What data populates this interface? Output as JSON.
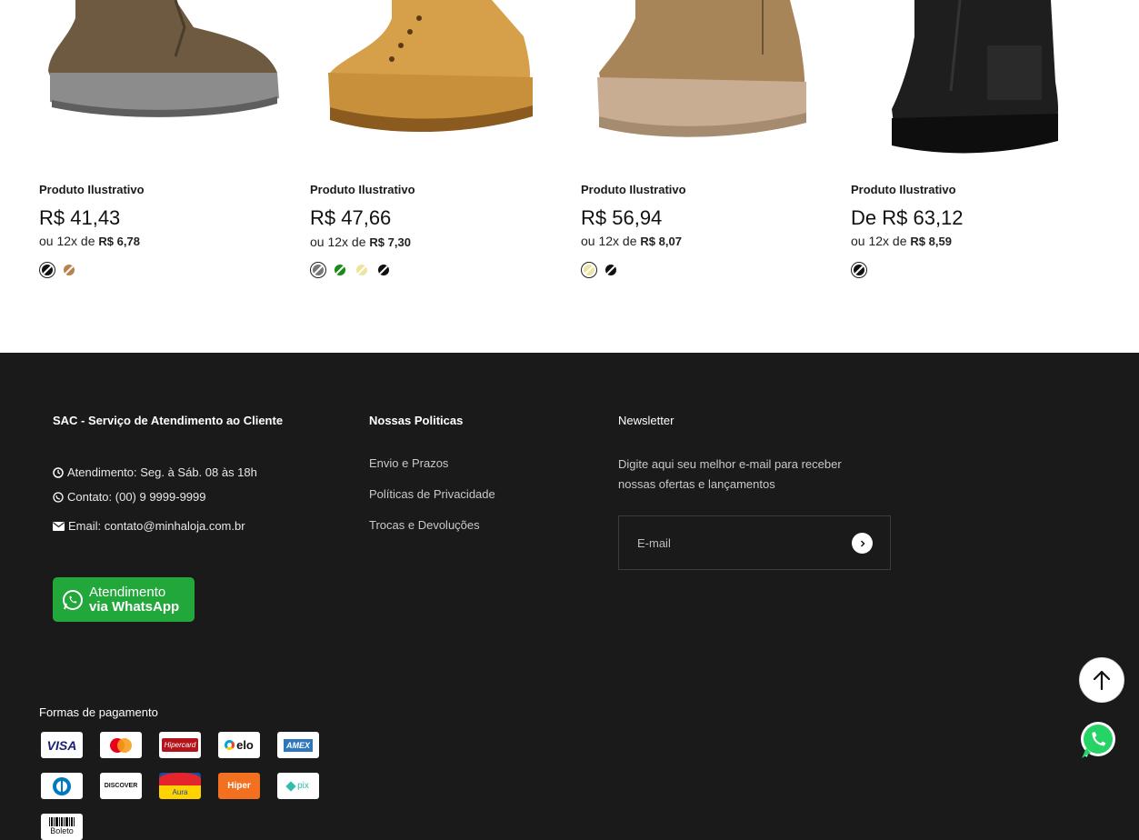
{
  "products": [
    {
      "name": "Produto Ilustrativo",
      "price": "R$ 41,43",
      "installment_prefix": "ou 12x de",
      "installment_value": "R$ 6,78",
      "swatches": [
        {
          "color": "#111111",
          "selected": true
        },
        {
          "color": "#b9824b",
          "selected": false
        }
      ]
    },
    {
      "name": "Produto Ilustrativo",
      "price": "R$ 47,66",
      "installment_prefix": "ou 12x de",
      "installment_value": "R$ 7,30",
      "swatches": [
        {
          "color": "#777777",
          "selected": true
        },
        {
          "color": "#1a8a1a",
          "selected": false
        },
        {
          "color": "#efe3a0",
          "selected": false
        },
        {
          "color": "#111111",
          "selected": false
        }
      ]
    },
    {
      "name": "Produto Ilustrativo",
      "price": "R$ 56,94",
      "installment_prefix": "ou 12x de",
      "installment_value": "R$ 8,07",
      "swatches": [
        {
          "color": "#efe3a0",
          "selected": true
        },
        {
          "color": "#111111",
          "selected": false
        }
      ]
    },
    {
      "name": "Produto Ilustrativo",
      "price": "De R$ 63,12",
      "installment_prefix": "ou 12x de",
      "installment_value": "R$ 8,59",
      "swatches": [
        {
          "color": "#111111",
          "selected": true
        }
      ]
    }
  ],
  "footer": {
    "sac": {
      "title": "SAC - Serviço de Atendimento ao Cliente",
      "hours": "Atendimento: Seg. à Sáb. 08 às 18h",
      "contact": "Contato: (00) 9 9999-9999",
      "email": "Email: contato@minhaloja.com.br",
      "whatsapp_line1": "Atendimento",
      "whatsapp_line2": "via WhatsApp"
    },
    "policies": {
      "title": "Nossas Politicas",
      "links": [
        "Envio e Prazos",
        "Políticas de Privacidade",
        "Trocas e Devoluções"
      ]
    },
    "newsletter": {
      "title": "Newsletter",
      "text": "Digite aqui seu melhor e-mail para receber nossas ofertas e lançamentos",
      "placeholder": "E-mail"
    },
    "payment": {
      "title": "Formas de pagamento",
      "methods": [
        {
          "icon": "visa-icon",
          "label": "VISA"
        },
        {
          "icon": "mastercard-icon",
          "label": ""
        },
        {
          "icon": "hipercard-icon",
          "label": "Hipercard"
        },
        {
          "icon": "elo-icon",
          "label": "elo"
        },
        {
          "icon": "amex-icon",
          "label": "AMEX"
        },
        {
          "icon": "diners-icon",
          "label": ""
        },
        {
          "icon": "discover-icon",
          "label": "DISCOVER"
        },
        {
          "icon": "aura-icon",
          "label": "Aura"
        },
        {
          "icon": "hiper-icon",
          "label": "Hiper"
        },
        {
          "icon": "pix-icon",
          "label": "pix"
        },
        {
          "icon": "boleto-icon",
          "label": "Boleto"
        }
      ]
    }
  },
  "colors": {
    "footer_bg": "#1a1a1a",
    "whatsapp_green": "#22a83a"
  }
}
